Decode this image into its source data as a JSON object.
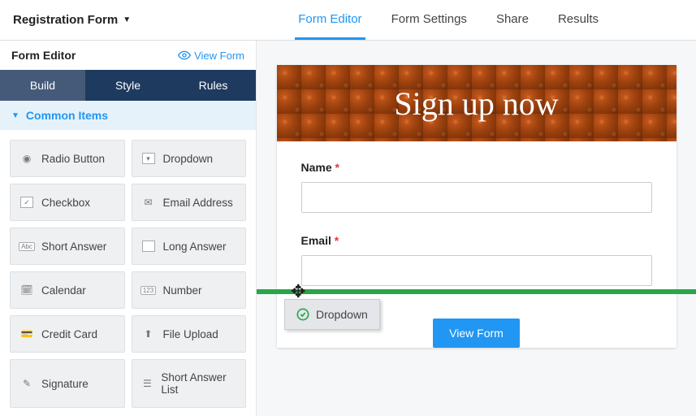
{
  "header": {
    "form_title": "Registration Form",
    "nav": [
      {
        "label": "Form Editor",
        "active": true
      },
      {
        "label": "Form Settings",
        "active": false
      },
      {
        "label": "Share",
        "active": false
      },
      {
        "label": "Results",
        "active": false
      }
    ]
  },
  "sidebar": {
    "title": "Form Editor",
    "view_form": "View Form",
    "tabs": [
      {
        "label": "Build",
        "active": true
      },
      {
        "label": "Style",
        "active": false
      },
      {
        "label": "Rules",
        "active": false
      }
    ],
    "section": "Common Items",
    "items": [
      {
        "label": "Radio Button",
        "icon": "radio"
      },
      {
        "label": "Dropdown",
        "icon": "dropdown"
      },
      {
        "label": "Checkbox",
        "icon": "checkbox"
      },
      {
        "label": "Email Address",
        "icon": "email"
      },
      {
        "label": "Short Answer",
        "icon": "abc"
      },
      {
        "label": "Long Answer",
        "icon": "long"
      },
      {
        "label": "Calendar",
        "icon": "calendar"
      },
      {
        "label": "Number",
        "icon": "123"
      },
      {
        "label": "Credit Card",
        "icon": "card"
      },
      {
        "label": "File Upload",
        "icon": "upload"
      },
      {
        "label": "Signature",
        "icon": "signature"
      },
      {
        "label": "Short Answer List",
        "icon": "list"
      }
    ]
  },
  "form": {
    "header_title": "Sign up now",
    "fields": [
      {
        "label": "Name",
        "required": true
      },
      {
        "label": "Email",
        "required": true
      }
    ],
    "view_button": "View Form"
  },
  "drag": {
    "label": "Dropdown"
  }
}
